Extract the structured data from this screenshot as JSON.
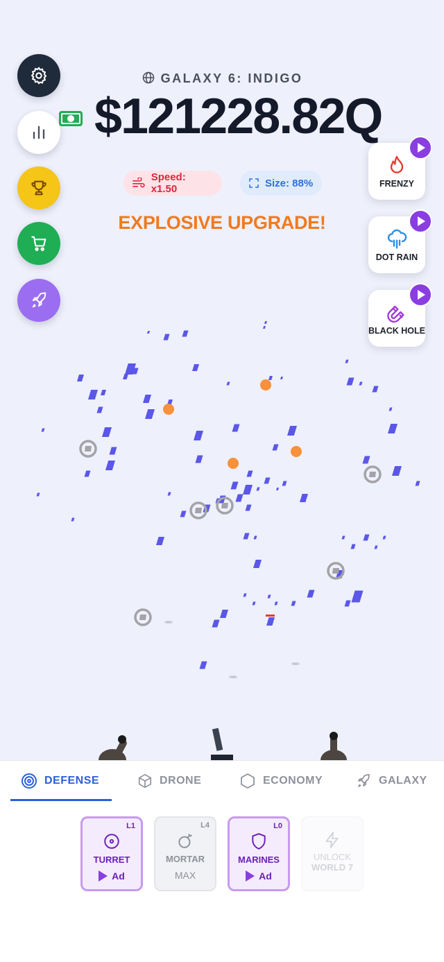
{
  "header": {
    "galaxy_label": "GALAXY 6: INDIGO",
    "money": "$121228.82Q",
    "speed": "Speed: x1.50",
    "size": "Size: 88%",
    "banner": "EXPLOSIVE UPGRADE!"
  },
  "left_buttons": [
    {
      "name": "settings",
      "icon": "gear-icon",
      "color": "#1f2a3a"
    },
    {
      "name": "stats",
      "icon": "bar-chart-icon",
      "color": "#ffffff"
    },
    {
      "name": "achievements",
      "icon": "trophy-icon",
      "color": "#f5c518"
    },
    {
      "name": "shop",
      "icon": "cart-icon",
      "color": "#1fae53"
    },
    {
      "name": "prestige",
      "icon": "rocket-icon",
      "color": "#9b6df0"
    }
  ],
  "powerups": [
    {
      "label": "FRENZY",
      "icon": "flame-icon"
    },
    {
      "label": "DOT RAIN",
      "icon": "rain-cloud-icon"
    },
    {
      "label": "BLACK HOLE",
      "icon": "magnet-icon"
    }
  ],
  "tabs": [
    {
      "label": "DEFENSE",
      "icon": "target-icon",
      "active": true
    },
    {
      "label": "DRONE",
      "icon": "cube-icon",
      "active": false
    },
    {
      "label": "ECONOMY",
      "icon": "hexagon-icon",
      "active": false
    },
    {
      "label": "GALAXY",
      "icon": "rocket-icon",
      "active": false
    }
  ],
  "cards": [
    {
      "name": "TURRET",
      "level": "L1",
      "action": "Ad",
      "state": "ad",
      "icon": "crosshair-icon"
    },
    {
      "name": "MORTAR",
      "level": "L4",
      "action": "MAX",
      "state": "max",
      "icon": "bomb-icon"
    },
    {
      "name": "MARINES",
      "level": "L0",
      "action": "Ad",
      "state": "ad",
      "icon": "shield-icon"
    },
    {
      "name": "UNLOCK",
      "name2": "WORLD 7",
      "state": "locked",
      "icon": "lightning-icon"
    }
  ],
  "colors": {
    "dot": "#5b57e8",
    "bomb": "#f7913a",
    "coin": "#a3a3a8",
    "accent": "#2b5fd9",
    "banner": "#f07a1e"
  }
}
